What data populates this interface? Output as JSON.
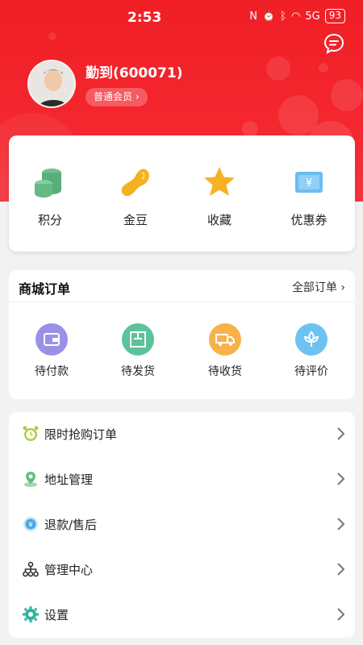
{
  "status_bar": {
    "time": "2:53",
    "battery": "93",
    "signal": "5G"
  },
  "profile": {
    "username": "勤到(600071)",
    "member_level": "普通会员 ›"
  },
  "quick_actions": [
    {
      "label": "积分",
      "icon": "coins-icon"
    },
    {
      "label": "金豆",
      "icon": "bean-icon"
    },
    {
      "label": "收藏",
      "icon": "star-icon"
    },
    {
      "label": "优惠券",
      "icon": "coupon-icon"
    }
  ],
  "orders": {
    "title": "商城订单",
    "view_all": "全部订单 ›",
    "items": [
      {
        "label": "待付款",
        "icon": "wallet-icon",
        "color": "#9a91e6"
      },
      {
        "label": "待发货",
        "icon": "box-icon",
        "color": "#5bc39a"
      },
      {
        "label": "待收货",
        "icon": "truck-icon",
        "color": "#f7b24a"
      },
      {
        "label": "待评价",
        "icon": "flower-icon",
        "color": "#6cc3f2"
      }
    ]
  },
  "menu": [
    {
      "label": "限时抢购订单",
      "icon": "alarm-clock-icon"
    },
    {
      "label": "地址管理",
      "icon": "location-icon"
    },
    {
      "label": "退款/售后",
      "icon": "refund-icon"
    },
    {
      "label": "管理中心",
      "icon": "network-icon"
    },
    {
      "label": "设置",
      "icon": "gear-icon"
    }
  ],
  "colors": {
    "brand": "#f01f26",
    "background": "#f2f2f2"
  }
}
